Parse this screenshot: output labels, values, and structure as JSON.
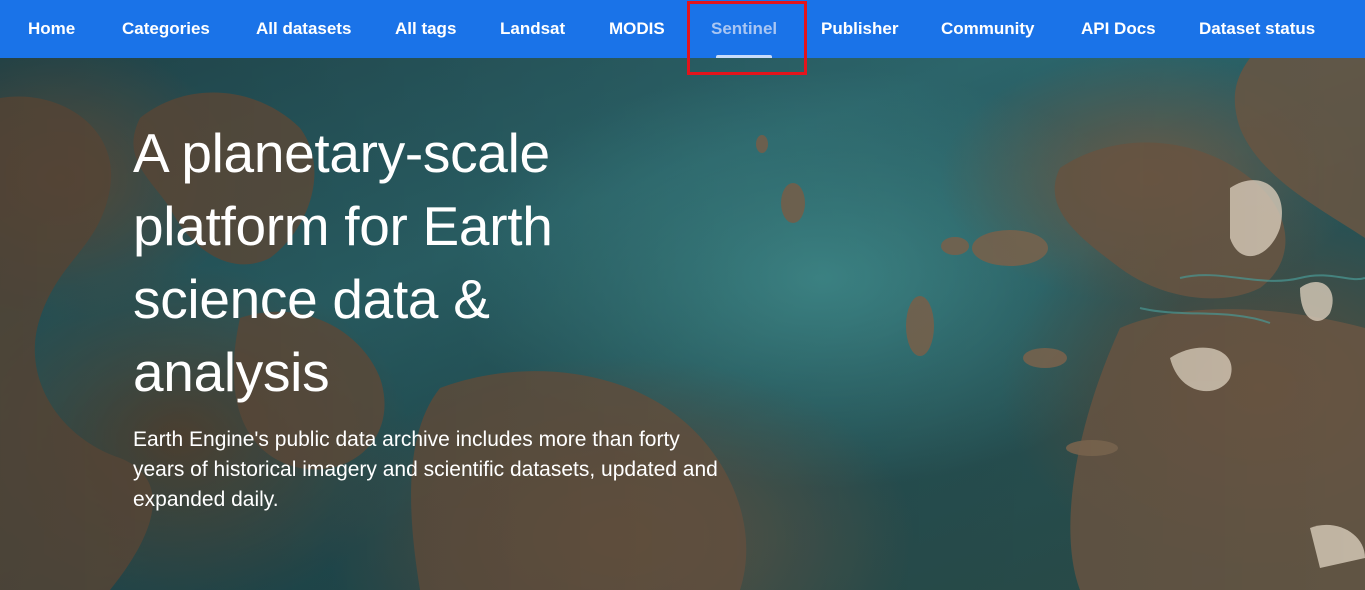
{
  "nav": {
    "items": [
      {
        "label": "Home"
      },
      {
        "label": "Categories"
      },
      {
        "label": "All datasets"
      },
      {
        "label": "All tags"
      },
      {
        "label": "Landsat"
      },
      {
        "label": "MODIS"
      },
      {
        "label": "Sentinel",
        "active": true
      },
      {
        "label": "Publisher"
      },
      {
        "label": "Community"
      },
      {
        "label": "API Docs"
      },
      {
        "label": "Dataset status"
      }
    ]
  },
  "hero": {
    "title": "A planetary-scale platform for Earth science data & analysis",
    "description": "Earth Engine's public data archive includes more than forty years of historical imagery and scientific datasets, updated and expanded daily."
  },
  "colors": {
    "nav_background": "#1a73e8",
    "nav_text": "#ffffff",
    "active_text": "#a9c6f3",
    "highlight_border": "#e3141c"
  }
}
